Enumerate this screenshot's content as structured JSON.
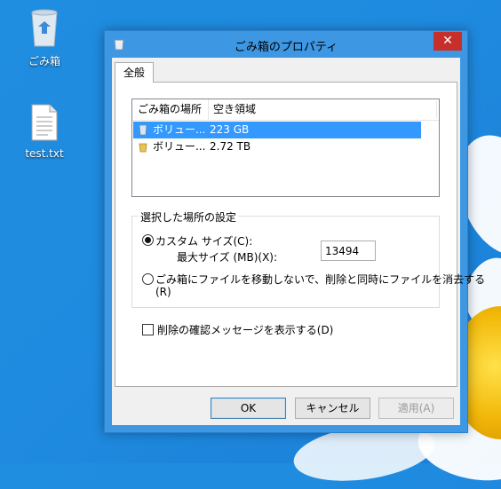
{
  "desktop": {
    "icons": [
      {
        "label": "ごみ箱"
      },
      {
        "label": "test.txt"
      }
    ]
  },
  "dialog": {
    "title": "ごみ箱のプロパティ",
    "close_symbol": "✕",
    "tab_general": "全般",
    "list": {
      "col_location": "ごみ箱の場所",
      "col_free_space": "空き領域",
      "rows": [
        {
          "location": "ボリュー...",
          "free_space": "223 GB",
          "selected": true
        },
        {
          "location": "ボリュー...",
          "free_space": "2.72 TB",
          "selected": false
        }
      ]
    },
    "settings_group": {
      "legend": "選択した場所の設定",
      "custom_size_label": "カスタム サイズ(C):",
      "max_size_label": "最大サイズ (MB)(X):",
      "max_size_value": "13494",
      "no_move_label": "ごみ箱にファイルを移動しないで、削除と同時にファイルを消去する",
      "no_move_label_cont": "(R)"
    },
    "confirm_delete_label": "削除の確認メッセージを表示する(D)",
    "buttons": {
      "ok": "OK",
      "cancel": "キャンセル",
      "apply": "適用(A)"
    }
  },
  "colors": {
    "desktop_bg": "#1f8de0",
    "title_bar": "#3d97e3",
    "close_button": "#c7302a",
    "selection": "#3399ff"
  }
}
